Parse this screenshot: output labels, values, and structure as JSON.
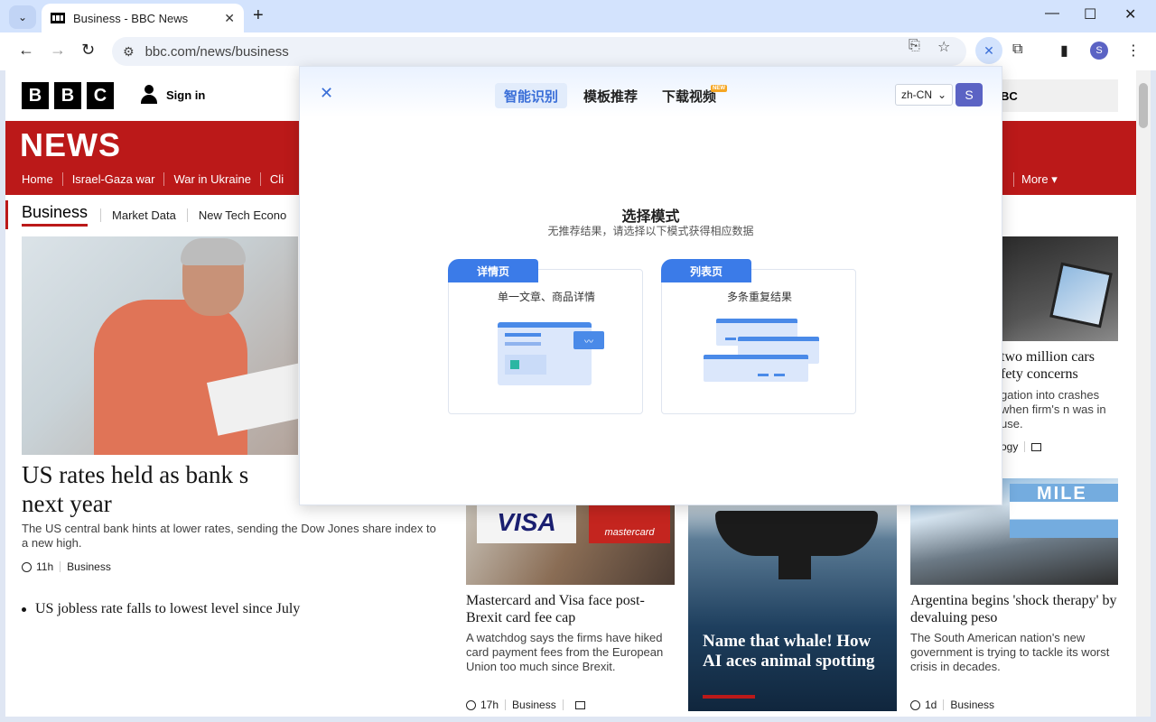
{
  "browser": {
    "tab_title": "Business - BBC News",
    "tab_close": "✕",
    "new_tab": "+",
    "url": "bbc.com/news/business",
    "profile_initial": "S",
    "icons": {
      "back": "←",
      "forward": "→",
      "reload": "↻",
      "translate": "⎘",
      "bookmark": "☆",
      "extensions": "⧉",
      "sidepanel": "▮",
      "menu": "⋮",
      "minimize": "—",
      "maximize": "☐",
      "close": "✕",
      "tab_search": "⌄"
    }
  },
  "bbc": {
    "logo": [
      "B",
      "B",
      "C"
    ],
    "sign_in": "Sign in",
    "search_partial": "BC",
    "news_title": "NEWS",
    "nav": [
      "Home",
      "Israel-Gaza war",
      "War in Ukraine",
      "Cli"
    ],
    "nav_more": "More ▾",
    "subnav_active": "Business",
    "subnav": [
      "Market Data",
      "New Tech Econo"
    ],
    "hero": {
      "title": "US rates held as bank s next year",
      "title_line1": "US rates held as bank s",
      "title_line2": "next year",
      "desc": "The US central bank hints at lower rates, sending the Dow Jones share index to a new high.",
      "time": "11h",
      "section": "Business"
    },
    "bullet": "US jobless rate falls to lowest level since July",
    "tesla": {
      "title": "two million cars fety concerns",
      "desc": "gation into crashes when firm's n was in use.",
      "section_partial": "ogy"
    },
    "visa": {
      "visa_text": "VISA",
      "mc_text": "mastercard",
      "title": "Mastercard and Visa face post-Brexit card fee cap",
      "desc": "A watchdog says the firms have hiked card payment fees from the European Union too much since Brexit.",
      "time": "17h",
      "section": "Business"
    },
    "whale": {
      "title": "Name that whale! How AI aces animal spotting"
    },
    "argentina": {
      "flag_text": "MILE",
      "title": "Argentina begins 'shock therapy' by devaluing peso",
      "desc": "The South American nation's new government is trying to tackle its worst crisis in decades.",
      "time": "1d",
      "section": "Business"
    }
  },
  "popup": {
    "tabs": [
      "智能识别",
      "模板推荐",
      "下载视频"
    ],
    "new_badge": "NEW",
    "language": "zh-CN",
    "avatar": "S",
    "title": "选择模式",
    "subtitle": "无推荐结果，请选择以下模式获得相应数据",
    "modes": [
      {
        "tag": "详情页",
        "desc": "单一文章、商品详情"
      },
      {
        "tag": "列表页",
        "desc": "多条重复结果"
      }
    ]
  },
  "colors": {
    "bbc_red": "#bb1919",
    "accent_blue": "#3b7be8",
    "chrome_blue": "#d3e3fd"
  }
}
